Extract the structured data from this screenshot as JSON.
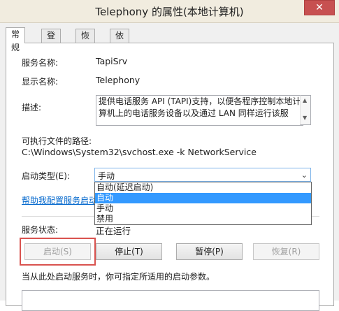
{
  "window": {
    "title": "Telephony 的属性(本地计算机)",
    "close_label": "✕"
  },
  "tabs": [
    {
      "label": "常规",
      "active": true
    },
    {
      "label": "登录",
      "active": false
    },
    {
      "label": "恢复",
      "active": false
    },
    {
      "label": "依存关系",
      "active": false
    }
  ],
  "general": {
    "service_name_label": "服务名称:",
    "service_name": "TapiSrv",
    "display_name_label": "显示名称:",
    "display_name": "Telephony",
    "description_label": "描述:",
    "description": "提供电话服务 API (TAPI)支持，以便各程序控制本地计算机上的电话服务设备以及通过 LAN 同样运行该服",
    "exe_path_label": "可执行文件的路径:",
    "exe_path": "C:\\Windows\\System32\\svchost.exe -k NetworkService",
    "startup_type_label": "启动类型(E):",
    "startup_type_value": "手动",
    "startup_options": [
      "自动(延迟启动)",
      "自动",
      "手动",
      "禁用"
    ],
    "highlighted_option": "自动",
    "help_link": "帮助我配置服务启动",
    "status_label": "服务状态:",
    "status_value": "正在运行"
  },
  "buttons": {
    "start": "启动(S)",
    "stop": "停止(T)",
    "pause": "暂停(P)",
    "resume": "恢复(R)"
  },
  "hint": "当从此处启动服务时，你可指定所适用的启动参数。",
  "colors": {
    "highlight_box": "#d9534f",
    "selection": "#3399ff",
    "link": "#0066cc",
    "close": "#c75050"
  }
}
